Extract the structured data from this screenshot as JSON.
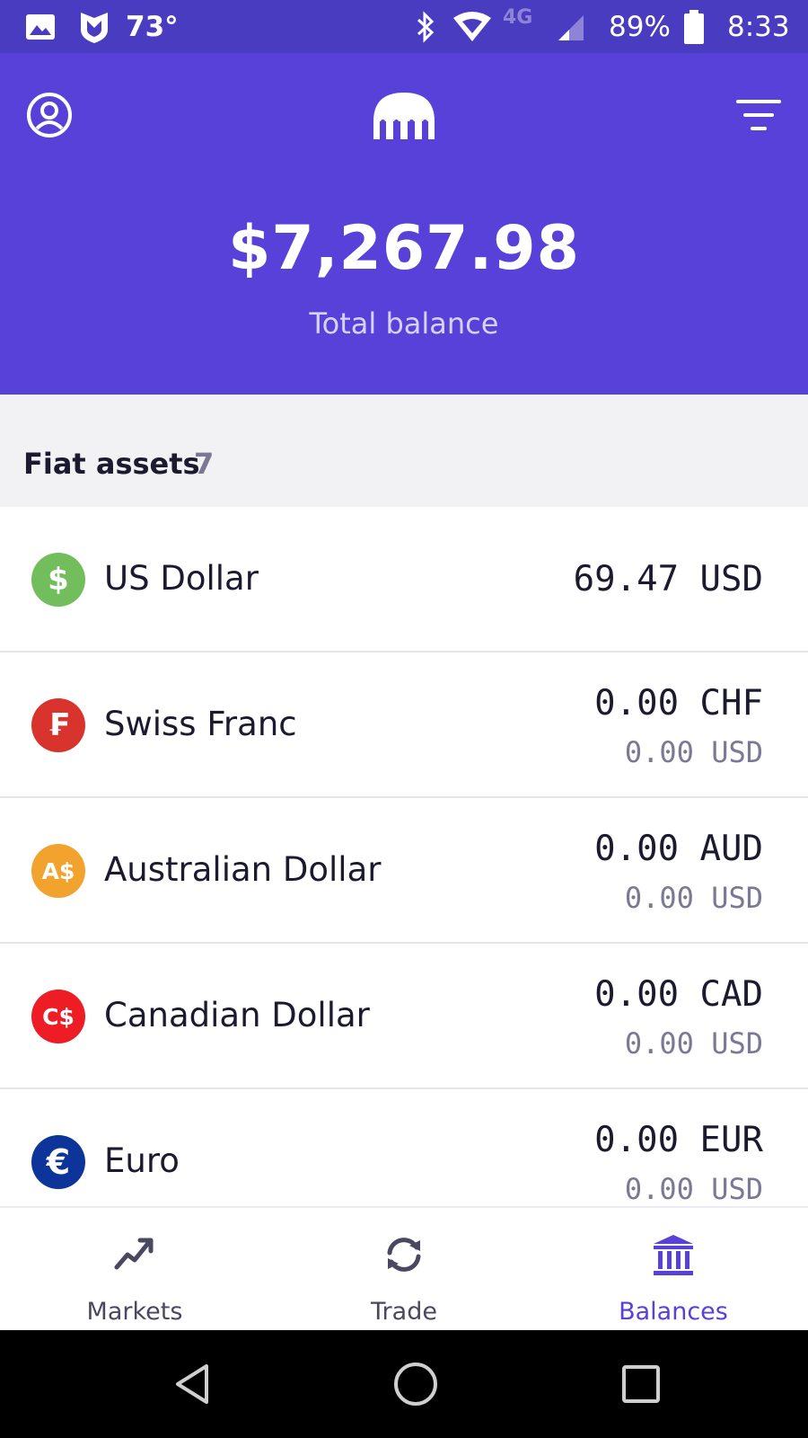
{
  "status_bar": {
    "icons": [
      "gallery-icon",
      "shield-app-icon",
      "bluetooth-icon",
      "wifi-icon",
      "signal-icon",
      "battery-icon"
    ],
    "temperature": "73°",
    "network": "4G",
    "battery": "89%",
    "time": "8:33"
  },
  "header": {
    "total_balance": "$7,267.98",
    "total_balance_label": "Total balance",
    "icons": [
      "account-icon",
      "kraken-logo-icon",
      "filter-icon"
    ]
  },
  "section": {
    "title": "Fiat assets",
    "count": "7"
  },
  "assets": [
    {
      "name": "US Dollar",
      "symbol": "$",
      "color": "#72bd5c",
      "amount": "69.47 USD",
      "usd": ""
    },
    {
      "name": "Swiss Franc",
      "symbol": "₣",
      "color": "#d8342d",
      "amount": "0.00 CHF",
      "usd": "0.00 USD"
    },
    {
      "name": "Australian Dollar",
      "symbol": "A$",
      "color": "#f1a32e",
      "amount": "0.00 AUD",
      "usd": "0.00 USD"
    },
    {
      "name": "Canadian Dollar",
      "symbol": "C$",
      "color": "#ee1c24",
      "amount": "0.00 CAD",
      "usd": "0.00 USD"
    },
    {
      "name": "Euro",
      "symbol": "€",
      "color": "#0d3498",
      "amount": "0.00 EUR",
      "usd": "0.00 USD"
    }
  ],
  "tabs": [
    {
      "label": "Markets",
      "icon": "trending-up-icon",
      "active": false
    },
    {
      "label": "Trade",
      "icon": "swap-refresh-icon",
      "active": false
    },
    {
      "label": "Balances",
      "icon": "bank-icon",
      "active": true
    }
  ],
  "colors": {
    "brand": "#5741d9",
    "status_bar": "#4a3cc0",
    "active_tab": "#5741d9"
  }
}
